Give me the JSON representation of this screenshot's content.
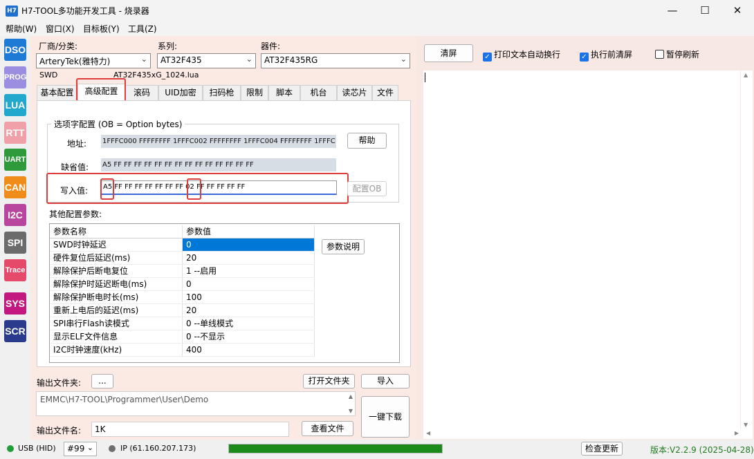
{
  "window": {
    "icon_text": "H7",
    "title": "H7-TOOL多功能开发工具 - 烧录器",
    "minimize": "—",
    "maximize": "☐",
    "close": "✕"
  },
  "menu": [
    "帮助(W)",
    "窗口(X)",
    "目标板(Y)",
    "工具(Z)"
  ],
  "sidebar": [
    {
      "label": "DSO",
      "color": "#1f7ad6"
    },
    {
      "label": "PROG",
      "color": "#9b8ee0"
    },
    {
      "label": "LUA",
      "color": "#22a8cc"
    },
    {
      "label": "RTT",
      "color": "#f0a0a8"
    },
    {
      "label": "UART",
      "color": "#2f9a3c"
    },
    {
      "label": "CAN",
      "color": "#f08c1a"
    },
    {
      "label": "I2C",
      "color": "#b8459e"
    },
    {
      "label": "SPI",
      "color": "#6b6b6b"
    },
    {
      "label": "Trace",
      "color": "#e64a6a"
    },
    {
      "label": "SYS",
      "color": "#c2187f"
    },
    {
      "label": "SCR",
      "color": "#2a3a8c"
    }
  ],
  "selectors": {
    "vendor_label": "厂商/分类:",
    "vendor_value": "ArteryTek(雅特力)",
    "series_label": "系列:",
    "series_value": "AT32F435",
    "device_label": "器件:",
    "device_value": "AT32F435RG",
    "interface": "SWD",
    "lua_file": "AT32F435xG_1024.lua"
  },
  "tabs": [
    "基本配置",
    "高级配置",
    "滚码",
    "UID加密",
    "扫码枪",
    "限制",
    "脚本",
    "机台",
    "读芯片",
    "文件"
  ],
  "option_bytes": {
    "group_title": "选项字配置  (OB = Option bytes)",
    "address_label": "地址:",
    "address_value": "1FFFC000 FFFFFFFF  1FFFC002 FFFFFFFF  1FFFC004 FFFFFFFF  1FFFC",
    "help_button": "帮助",
    "default_label": "缺省值:",
    "default_value": "A5 FF FF FF FF FF FF FF FF FF FF FF FF FF FF",
    "write_label": "写入值:",
    "write_value": "A5 FF FF FF FF FF FF FF 02 FF FF FF FF FF",
    "config_button": "配置OB"
  },
  "params": {
    "section_label": "其他配置参数:",
    "col_name": "参数名称",
    "col_value": "参数值",
    "explain_button": "参数说明",
    "rows": [
      {
        "name": "SWD时钟延迟",
        "value": "0"
      },
      {
        "name": "硬件复位后延迟(ms)",
        "value": "20"
      },
      {
        "name": "解除保护后断电复位",
        "value": "1 --启用"
      },
      {
        "name": "解除保护时延迟断电(ms)",
        "value": "0"
      },
      {
        "name": "解除保护断电时长(ms)",
        "value": "100"
      },
      {
        "name": "重新上电后的延迟(ms)",
        "value": "20"
      },
      {
        "name": "SPI串行Flash读模式",
        "value": "0 --单线模式"
      },
      {
        "name": "显示ELF文件信息",
        "value": "0 --不显示"
      },
      {
        "name": "I2C时钟速度(kHz)",
        "value": "400"
      }
    ]
  },
  "output": {
    "folder_label": "输出文件夹:",
    "browse_button": "...",
    "open_folder_button": "打开文件夹",
    "import_button": "导入",
    "path": "EMMC\\H7-TOOL\\Programmer\\User\\Demo",
    "download_button": "一键下载",
    "filename_label": "输出文件名:",
    "filename_value": "1K",
    "view_file_button": "查看文件"
  },
  "log": {
    "clear_button": "清屏",
    "auto_wrap_label": "打印文本自动换行",
    "clear_before_label": "执行前清屏",
    "pause_label": "暂停刷新"
  },
  "status": {
    "usb_label": "USB (HID)",
    "device_num": "#99",
    "ip_label": "IP (61.160.207.173)",
    "check_update": "检查更新",
    "version": "版本:V2.2.9 (2025-04-28)",
    "progress": 1.0
  }
}
